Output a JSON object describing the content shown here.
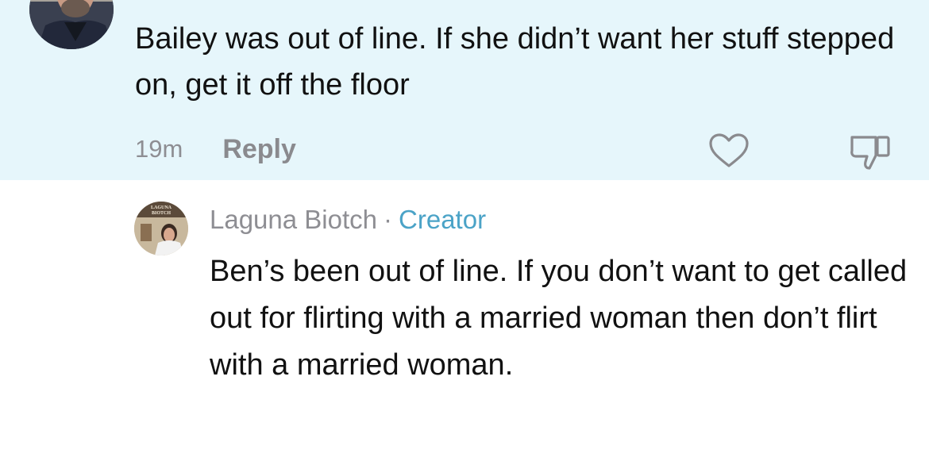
{
  "parent_comment": {
    "text": "Bailey was out of line. If she didn’t want her stuff stepped on, get it off the floor",
    "timestamp": "19m",
    "reply_label": "Reply",
    "like_icon": "heart-outline-icon",
    "dislike_icon": "thumbs-down-outline-icon",
    "background_color": "#e6f6fb"
  },
  "reply_comment": {
    "author": "Laguna Biotch",
    "separator": "·",
    "badge": "Creator",
    "badge_color": "#4ba3c7",
    "avatar_text": "LAGUNA BIOTCH",
    "text": "Ben’s been out of line. If you don’t want to get called out for flirting with a married woman then don’t flirt with a married woman."
  }
}
